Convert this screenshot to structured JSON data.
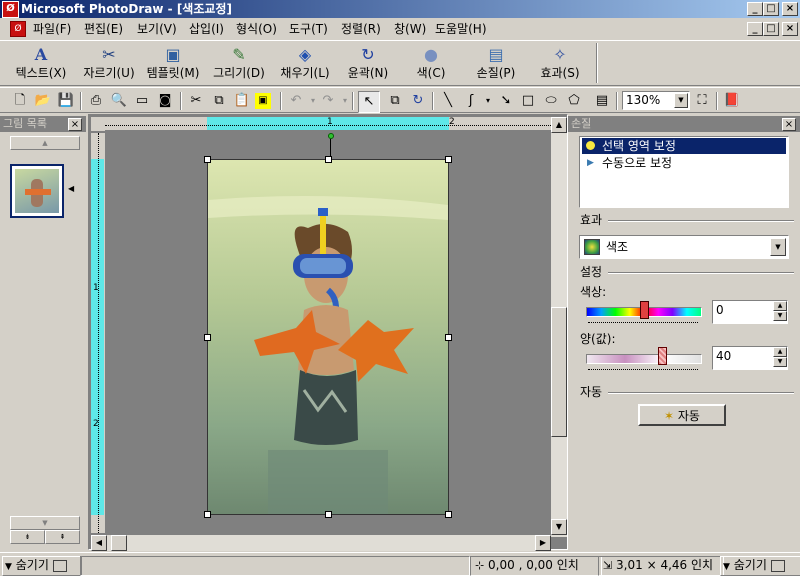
{
  "window": {
    "title": "Microsoft PhotoDraw - [색조교정]",
    "app_icon": "photodraw-app-icon"
  },
  "menu": [
    "파일(F)",
    "편집(E)",
    "보기(V)",
    "삽입(I)",
    "형식(O)",
    "도구(T)",
    "정렬(R)",
    "창(W)",
    "도움말(H)"
  ],
  "big_toolbar": [
    {
      "label": "텍스트(X)",
      "icon": "text-icon"
    },
    {
      "label": "자르기(U)",
      "icon": "scissors-icon"
    },
    {
      "label": "템플릿(M)",
      "icon": "template-icon"
    },
    {
      "label": "그리기(D)",
      "icon": "draw-icon"
    },
    {
      "label": "채우기(L)",
      "icon": "fill-icon"
    },
    {
      "label": "윤곽(N)",
      "icon": "outline-icon"
    },
    {
      "label": "색(C)",
      "icon": "color-icon"
    },
    {
      "label": "손질(P)",
      "icon": "touchup-icon"
    },
    {
      "label": "효과(S)",
      "icon": "effects-icon"
    }
  ],
  "small_toolbar": {
    "zoom": "130%"
  },
  "left_panel": {
    "title": "그림 목록"
  },
  "right_panel": {
    "title": "손질",
    "list_items": [
      {
        "label": "선택 영역 보정",
        "selected": true
      },
      {
        "label": "수동으로 보정",
        "selected": false
      }
    ],
    "effect_group": "효과",
    "effect_value": "색조",
    "settings_group": "설정",
    "hue_label": "색상:",
    "hue_value": "0",
    "amount_label": "양(값):",
    "amount_value": "40",
    "auto_group": "자동",
    "auto_button": "자동"
  },
  "status_bar": {
    "hide_left": "숨기기",
    "position": "0,00 , 0,00 인치",
    "size": "3,01 × 4,46 인치",
    "hide_right": "숨기기"
  },
  "colors": {
    "title_gradient_start": "#0a246a",
    "title_gradient_end": "#a6caf0",
    "selection": "#0a246a",
    "ruler_highlight": "#5ee8e8"
  }
}
